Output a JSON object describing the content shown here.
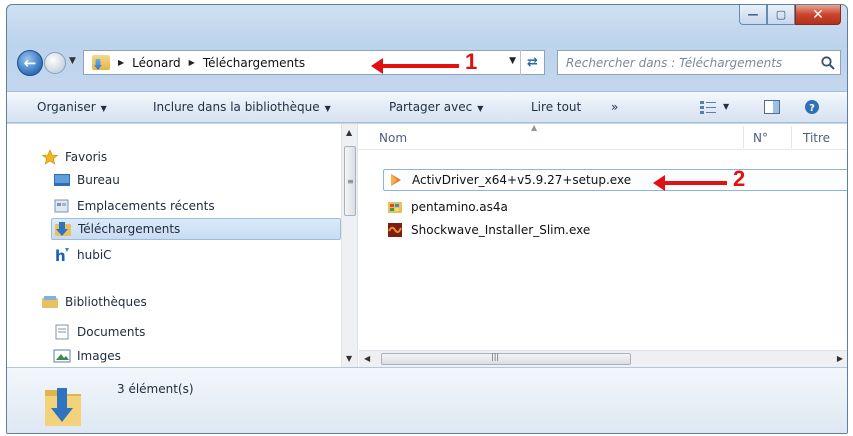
{
  "window": {
    "caption": {
      "minimize": "—",
      "maximize": "▢",
      "close": "✕"
    }
  },
  "address": {
    "crumbs": [
      "Léonard",
      "Téléchargements"
    ],
    "search_placeholder": "Rechercher dans : Téléchargements"
  },
  "annotations": {
    "arrow1_label": "1",
    "arrow2_label": "2",
    "color": "#e21010"
  },
  "toolbar": {
    "organize": "Organiser",
    "include_library": "Inclure dans la bibliothèque",
    "share_with": "Partager avec",
    "play_all": "Lire tout",
    "more": "»"
  },
  "navpane": {
    "favorites": "Favoris",
    "desktop": "Bureau",
    "recent_places": "Emplacements récents",
    "downloads": "Téléchargements",
    "hubic": "hubiC",
    "libraries": "Bibliothèques",
    "documents": "Documents",
    "images": "Images"
  },
  "filelist": {
    "columns": {
      "name": "Nom",
      "number": "N°",
      "title": "Titre"
    },
    "files": [
      {
        "name": "ActivDriver_x64+v5.9.27+setup.exe",
        "icon": "installer-icon"
      },
      {
        "name": "pentamino.as4a",
        "icon": "puzzle-file-icon"
      },
      {
        "name": "Shockwave_Installer_Slim.exe",
        "icon": "shockwave-icon"
      }
    ]
  },
  "details": {
    "item_count": "3 élément(s)"
  },
  "colors": {
    "accent": "#2c6fb8",
    "selection": "#c7dcf3"
  }
}
